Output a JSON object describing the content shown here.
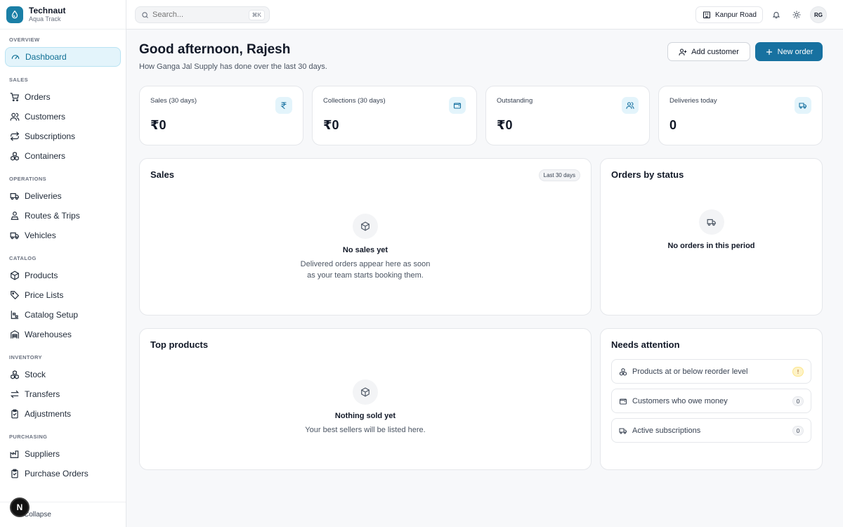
{
  "brand": {
    "name": "Technaut",
    "sub": "Aqua Track"
  },
  "sidebar": {
    "sections": [
      {
        "title": "OVERVIEW",
        "items": [
          {
            "label": "Dashboard",
            "icon": "gauge-icon",
            "active": true
          }
        ]
      },
      {
        "title": "SALES",
        "items": [
          {
            "label": "Orders",
            "icon": "cart-icon"
          },
          {
            "label": "Customers",
            "icon": "users-icon"
          },
          {
            "label": "Subscriptions",
            "icon": "repeat-icon"
          },
          {
            "label": "Containers",
            "icon": "boxes-icon"
          }
        ]
      },
      {
        "title": "OPERATIONS",
        "items": [
          {
            "label": "Deliveries",
            "icon": "truck-icon"
          },
          {
            "label": "Routes & Trips",
            "icon": "route-icon"
          },
          {
            "label": "Vehicles",
            "icon": "truck-icon"
          }
        ]
      },
      {
        "title": "CATALOG",
        "items": [
          {
            "label": "Products",
            "icon": "package-icon"
          },
          {
            "label": "Price Lists",
            "icon": "tag-icon"
          },
          {
            "label": "Catalog Setup",
            "icon": "sliders-icon"
          },
          {
            "label": "Warehouses",
            "icon": "warehouse-icon"
          }
        ]
      },
      {
        "title": "INVENTORY",
        "items": [
          {
            "label": "Stock",
            "icon": "boxes-icon"
          },
          {
            "label": "Transfers",
            "icon": "arrows-icon"
          },
          {
            "label": "Adjustments",
            "icon": "clipboard-icon"
          }
        ]
      },
      {
        "title": "PURCHASING",
        "items": [
          {
            "label": "Suppliers",
            "icon": "factory-icon"
          },
          {
            "label": "Purchase Orders",
            "icon": "clipboard-icon"
          }
        ]
      }
    ],
    "collapse_label": "Collapse",
    "n_badge": "N"
  },
  "topbar": {
    "search_placeholder": "Search...",
    "search_shortcut": "⌘K",
    "branch": "Kanpur Road",
    "avatar": "RG"
  },
  "header": {
    "greeting": "Good afternoon, Rajesh",
    "subtitle": "How Ganga Jal Supply has done over the last 30 days.",
    "add_customer": "Add customer",
    "new_order": "New order"
  },
  "stats": [
    {
      "label": "Sales (30 days)",
      "value": "₹0",
      "icon": "rupee-icon"
    },
    {
      "label": "Collections (30 days)",
      "value": "₹0",
      "icon": "wallet-icon"
    },
    {
      "label": "Outstanding",
      "value": "₹0",
      "icon": "users-icon"
    },
    {
      "label": "Deliveries today",
      "value": "0",
      "icon": "truck-icon"
    }
  ],
  "sales_card": {
    "title": "Sales",
    "range": "Last 30 days",
    "empty_title": "No sales yet",
    "empty_desc_1": "Delivered orders appear here as soon",
    "empty_desc_2": "as your team starts booking them."
  },
  "status_card": {
    "title": "Orders by status",
    "empty_title": "No orders in this period"
  },
  "top_products": {
    "title": "Top products",
    "empty_title": "Nothing sold yet",
    "empty_desc": "Your best sellers will be listed here."
  },
  "attention": {
    "title": "Needs attention",
    "items": [
      {
        "label": "Products at or below reorder level",
        "badge": "!",
        "icon": "boxes-icon"
      },
      {
        "label": "Customers who owe money",
        "badge": "0",
        "icon": "wallet-icon"
      },
      {
        "label": "Active subscriptions",
        "badge": "0",
        "icon": "truck-icon"
      }
    ]
  },
  "colors": {
    "accent": "#1771a0",
    "active_bg": "#e3f4fb",
    "border": "#e5e7eb"
  }
}
